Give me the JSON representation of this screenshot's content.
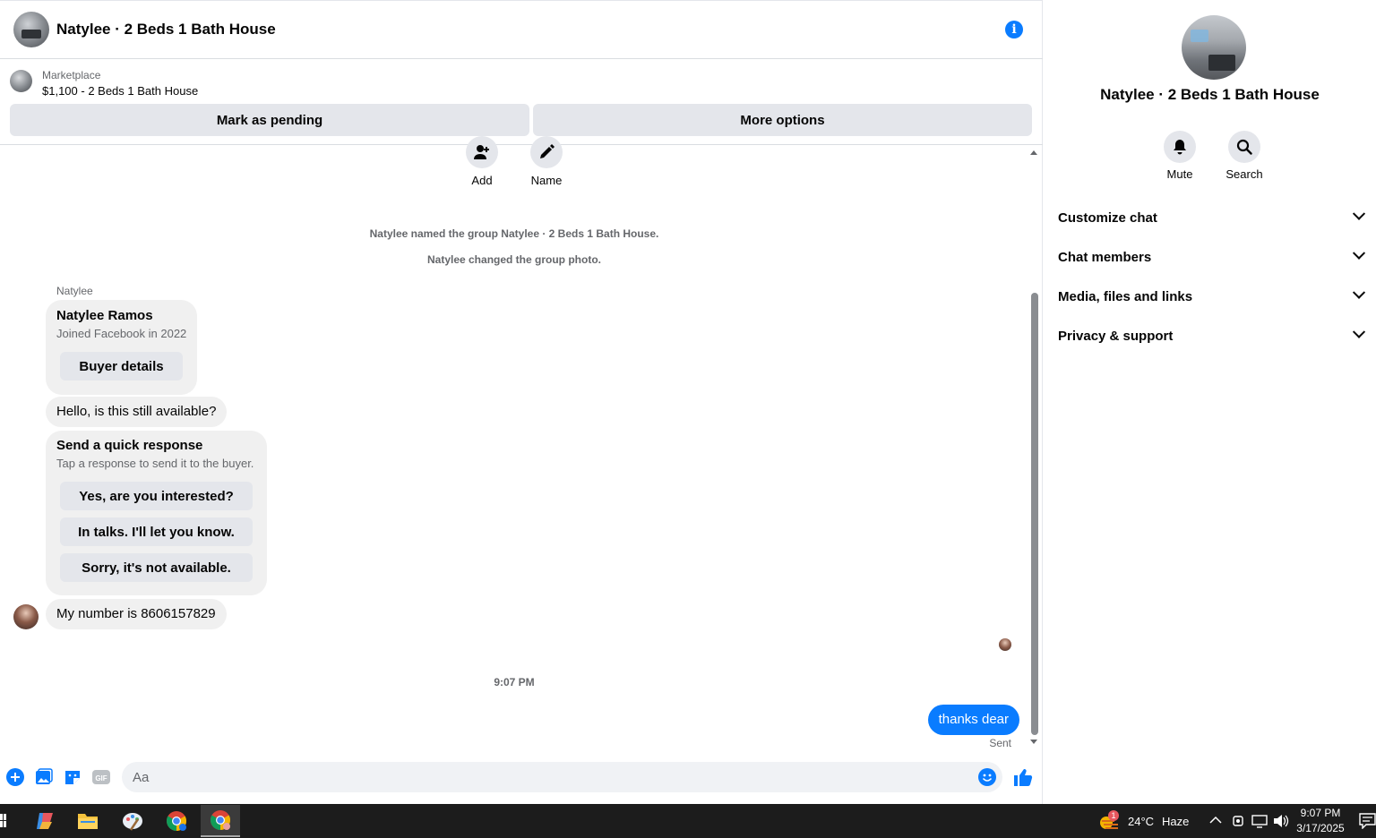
{
  "header": {
    "title": "Natylee · 2 Beds 1 Bath House",
    "info_icon": "info-icon"
  },
  "marketplace": {
    "label": "Marketplace",
    "listing": "$1,100 - 2 Beds 1 Bath House",
    "mark_pending": "Mark as pending",
    "more_options": "More options"
  },
  "group_actions": {
    "add": "Add",
    "name": "Name"
  },
  "messages": {
    "system_1": "Natylee named the group Natylee · 2 Beds 1 Bath House.",
    "system_2": "Natylee changed the group photo.",
    "sender": "Natylee",
    "buyer_card": {
      "name": "Natylee Ramos",
      "joined": "Joined Facebook in 2022",
      "button": "Buyer details"
    },
    "buyer_msg_1": "Hello, is this still available?",
    "quick_response": {
      "title": "Send a quick response",
      "subtitle": "Tap a response to send it to the buyer.",
      "options": [
        "Yes, are you interested?",
        "In talks. I'll let you know.",
        "Sorry, it's not available."
      ]
    },
    "buyer_msg_2": "My number is 8606157829",
    "timestamp": "9:07 PM",
    "my_msg": "thanks dear",
    "status": "Sent"
  },
  "composer": {
    "placeholder": "Aa",
    "value": "",
    "icons": [
      "plus-icon",
      "photo-icon",
      "sticker-icon",
      "gif-icon",
      "emoji-icon",
      "like-icon"
    ]
  },
  "panel": {
    "title": "Natylee · 2 Beds 1 Bath House",
    "mute": "Mute",
    "search": "Search",
    "sections": [
      "Customize chat",
      "Chat members",
      "Media, files and links",
      "Privacy & support"
    ]
  },
  "taskbar": {
    "weather_temp": "24°C",
    "weather_desc": "Haze",
    "weather_badge": "1",
    "time": "9:07 PM",
    "date": "3/17/2025"
  },
  "colors": {
    "accent": "#0a7cff",
    "bubble": "#f0f0f0",
    "button": "#e4e6eb",
    "muted": "#65676b"
  }
}
